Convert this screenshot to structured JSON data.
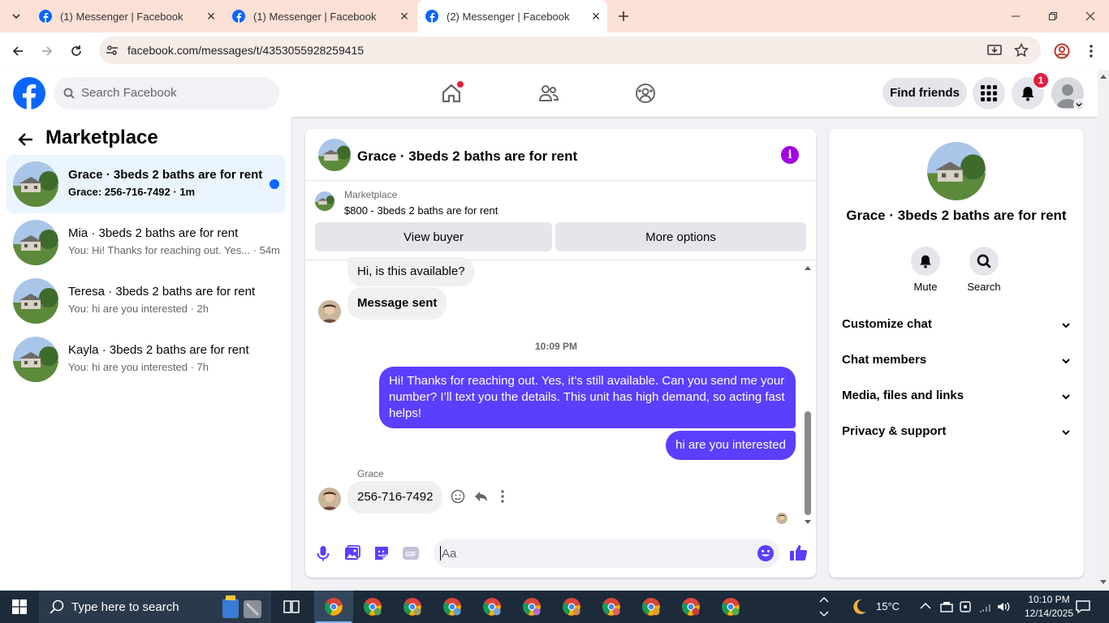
{
  "browser": {
    "tabs": [
      {
        "title": "(1) Messenger | Facebook",
        "active": false
      },
      {
        "title": "(1) Messenger | Facebook",
        "active": false
      },
      {
        "title": "(2) Messenger | Facebook",
        "active": true
      }
    ],
    "url": "facebook.com/messages/t/4353055928259415"
  },
  "fb_header": {
    "search_placeholder": "Search Facebook",
    "find_friends_label": "Find friends",
    "notification_count": "1"
  },
  "sidebar": {
    "title": "Marketplace",
    "conversations": [
      {
        "name": "Grace · 3beds 2 baths are for rent",
        "preview": "Grace: 256-716-7492 · 1m",
        "selected": true
      },
      {
        "name": "Mia · 3beds 2 baths are for rent",
        "preview": "You: Hi! Thanks for reaching out. Yes... · 54m",
        "selected": false
      },
      {
        "name": "Teresa · 3beds 2 baths are for rent",
        "preview": "You: hi are you interested · 2h",
        "selected": false
      },
      {
        "name": "Kayla · 3beds 2 baths are for rent",
        "preview": "You: hi are you interested · 7h",
        "selected": false
      }
    ]
  },
  "chat": {
    "title": "Grace · 3beds 2 baths are for rent",
    "listing": {
      "source": "Marketplace",
      "price_title": "$800 - 3beds 2 baths are for rent",
      "view_buyer_label": "View buyer",
      "more_options_label": "More options"
    },
    "messages": {
      "m1": "Hi, is this available?",
      "m2": "Message sent",
      "timestamp": "10:09 PM",
      "m3": "Hi! Thanks for reaching out. Yes, it’s still available. Can you send me your number? I’ll text you the details. This unit has high demand, so acting fast helps!",
      "m4": "hi are you interested",
      "sender_label": "Grace",
      "m5": "256-716-7492"
    },
    "composer_placeholder": "Aa"
  },
  "right_panel": {
    "name": "Grace · 3beds 2 baths are for rent",
    "mute_label": "Mute",
    "search_label": "Search",
    "sections": [
      "Customize chat",
      "Chat members",
      "Media, files and links",
      "Privacy & support"
    ]
  },
  "taskbar": {
    "search_placeholder": "Type here to search",
    "weather": "15°C",
    "time": "10:10 PM",
    "date": "12/14/2025"
  },
  "colors": {
    "accent_purple": "#5b3fff",
    "fb_blue": "#0866ff",
    "info_purple": "#a100e6"
  }
}
